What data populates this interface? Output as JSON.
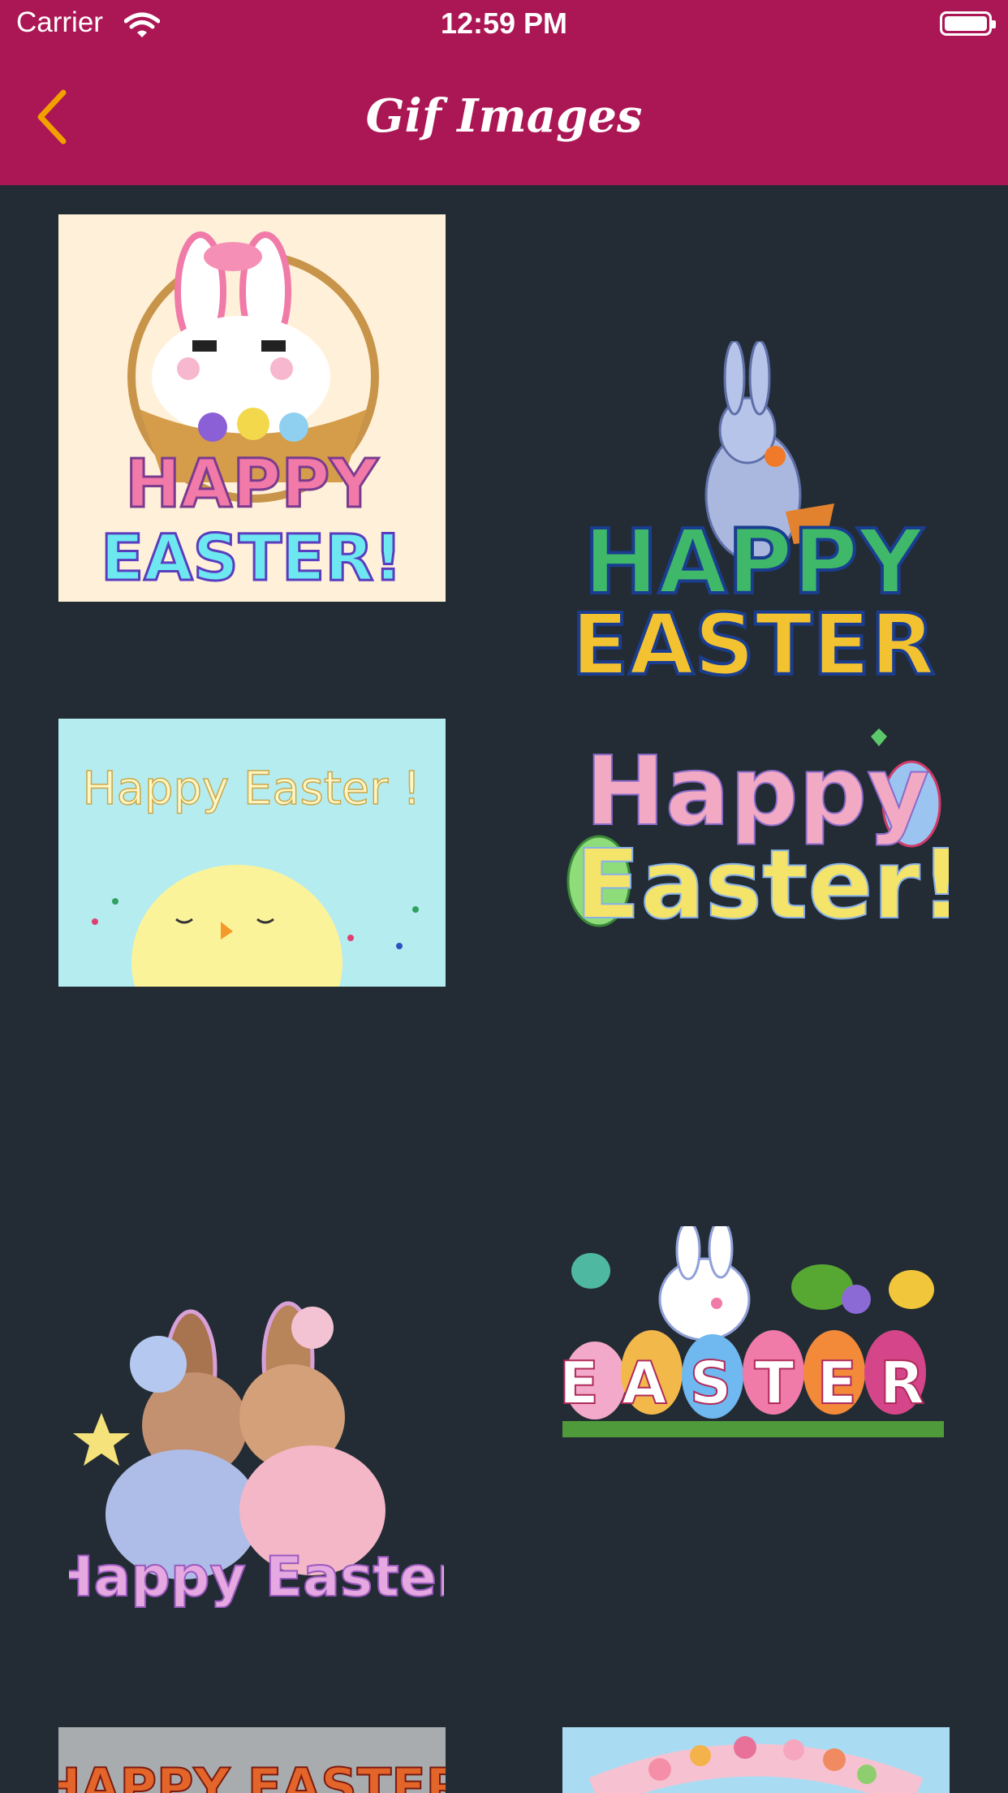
{
  "status_bar": {
    "carrier": "Carrier",
    "time": "12:59 PM"
  },
  "nav": {
    "title": "Gif Images",
    "back_icon": "chevron-left-icon",
    "accent": "#f2a000",
    "bar_color": "#ab1654"
  },
  "grid": {
    "background": "#232c34",
    "items": [
      {
        "caption_line1": "HAPPY",
        "caption_line2": "EASTER!"
      },
      {
        "caption_line1": "HAPPY",
        "caption_line2": "EASTER"
      },
      {
        "caption_line1": "Happy Easter !"
      },
      {
        "caption_line1": "Happy",
        "caption_line2": "Easter!"
      },
      {
        "caption_line1": "Happy Easter"
      },
      {
        "caption_line1": "EASTER"
      },
      {
        "caption_line1": "HAPPY EASTER"
      },
      {
        "caption_line1": ""
      }
    ]
  }
}
